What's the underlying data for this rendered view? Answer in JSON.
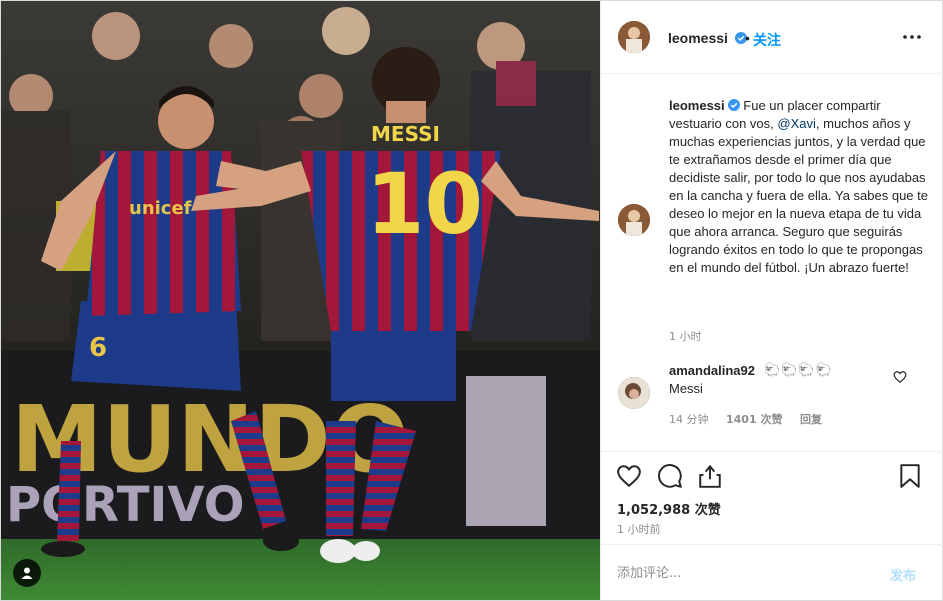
{
  "post": {
    "username": "leomessi",
    "verified": true,
    "separator": "•",
    "follow_label": "关注",
    "more_icon": "more-horizontal-icon"
  },
  "photo": {
    "description_icon": "user-tag-icon",
    "jersey_name": "MESSI",
    "jersey_number": "10",
    "teammate_number": "6",
    "sponsor": "unicef",
    "board_text_1": "MUNDO",
    "board_text_2": "PORTIVO"
  },
  "caption": {
    "username": "leomessi",
    "text_before": "Fue un placer compartir vestuario con vos, ",
    "mention": "@Xavi",
    "text_after": ", muchos años y muchas experiencias juntos, y la verdad que te extrañamos desde el primer día que decidiste salir, por todo lo que nos ayudabas en la cancha y fuera de ella. Ya sabes que te deseo lo mejor en la nueva etapa de tu vida que ahora arranca. Seguro que seguirás logrando éxitos en todo lo que te propongas en el mundo del fútbol. ¡Un abrazo fuerte!",
    "time": "1 小时"
  },
  "reply": {
    "username": "amandalina92",
    "emoji": "🐑🐑🐑🐑",
    "text": "Messi",
    "time": "14 分钟",
    "likes": "1401 次赞",
    "reply_label": "回复"
  },
  "actions": {
    "likes": "1,052,988 次赞",
    "time": "1 小时前"
  },
  "add_comment": {
    "placeholder": "添加评论...",
    "post_label": "发布"
  },
  "colors": {
    "accent": "#0095f6",
    "mention": "#00376b",
    "muted": "#8e8e8e",
    "border": "#efefef"
  }
}
